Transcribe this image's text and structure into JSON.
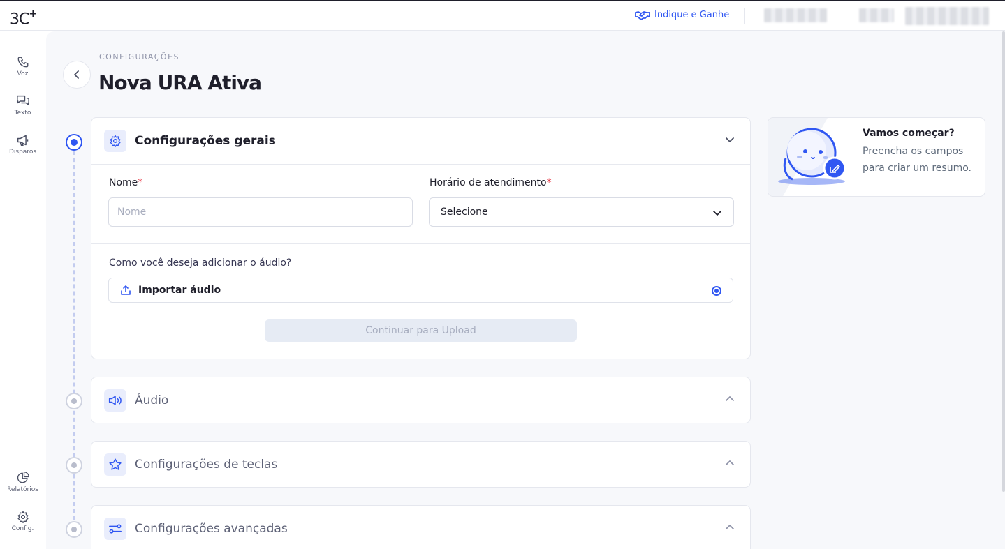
{
  "brand": {
    "logo": "3C",
    "logo_plus": "+"
  },
  "topbar": {
    "refer_label": "Indique e Ganhe"
  },
  "sidebar": {
    "items": [
      {
        "label": "Voz",
        "icon": "phone-icon"
      },
      {
        "label": "Texto",
        "icon": "chat-icon"
      },
      {
        "label": "Disparos",
        "icon": "megaphone-icon"
      },
      {
        "label": "Relatórios",
        "icon": "chart-pie-icon"
      },
      {
        "label": "Config.",
        "icon": "gear-icon"
      }
    ]
  },
  "header": {
    "breadcrumb": "Configurações",
    "title": "Nova URA Ativa"
  },
  "sections": {
    "general": {
      "title": "Configurações gerais",
      "name_label": "Nome",
      "name_placeholder": "Nome",
      "name_value": "",
      "hours_label": "Horário de atendimento",
      "hours_value": "Selecione",
      "required_mark": "*",
      "audio_question": "Como você deseja adicionar o áudio?",
      "import_option": "Importar áudio",
      "continue_label": "Continuar para Upload"
    },
    "audio": {
      "title": "Áudio"
    },
    "keys": {
      "title": "Configurações de teclas"
    },
    "advanced": {
      "title": "Configurações avançadas"
    }
  },
  "summary": {
    "title": "Vamos começar?",
    "text": "Preencha os campos para criar um resumo."
  },
  "colors": {
    "accent": "#3057f2",
    "background": "#f7f8fb",
    "required": "#e63946"
  }
}
